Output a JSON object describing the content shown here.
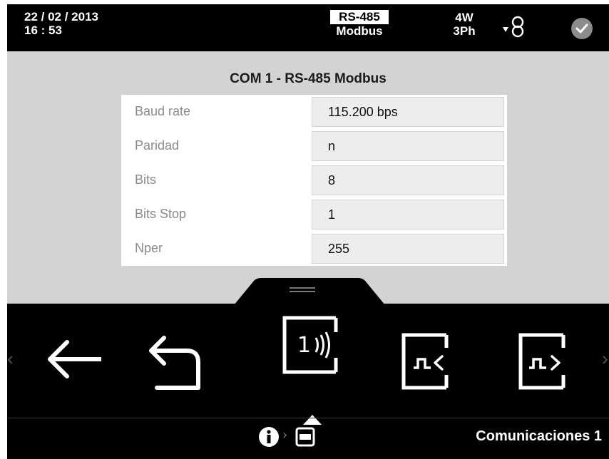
{
  "header": {
    "date": "22 / 02 / 2013",
    "time": "16 : 53",
    "protocol_line1": "RS-485",
    "protocol_line2": "Modbus",
    "wiring_line1": "4W",
    "wiring_line2": "3Ph",
    "icons": [
      "transformer-icon",
      "check-circle-icon"
    ]
  },
  "content": {
    "title": "COM 1 - RS-485 Modbus",
    "rows": [
      {
        "label": "Baud rate",
        "value": "115.200 bps"
      },
      {
        "label": "Paridad",
        "value": "n"
      },
      {
        "label": "Bits",
        "value": "8"
      },
      {
        "label": "Bits Stop",
        "value": "1"
      },
      {
        "label": "Nper",
        "value": "255"
      }
    ]
  },
  "toolbar": {
    "buttons": [
      "arrow-left-icon",
      "undo-icon",
      "com1-wireless-icon",
      "signal-in-icon",
      "signal-out-icon"
    ],
    "selected_button": "com1-wireless-icon",
    "com_number": "1"
  },
  "footer": {
    "icons": [
      "info-icon",
      "screen-icon"
    ],
    "title": "Comunicaciones 1"
  },
  "colors": {
    "header_bg": "#000000",
    "content_bg": "#d3d3d3",
    "table_bg": "#ffffff",
    "value_bg": "#ededed",
    "icon_color": "#ffffff",
    "check_circle": "#8c8c8c"
  }
}
